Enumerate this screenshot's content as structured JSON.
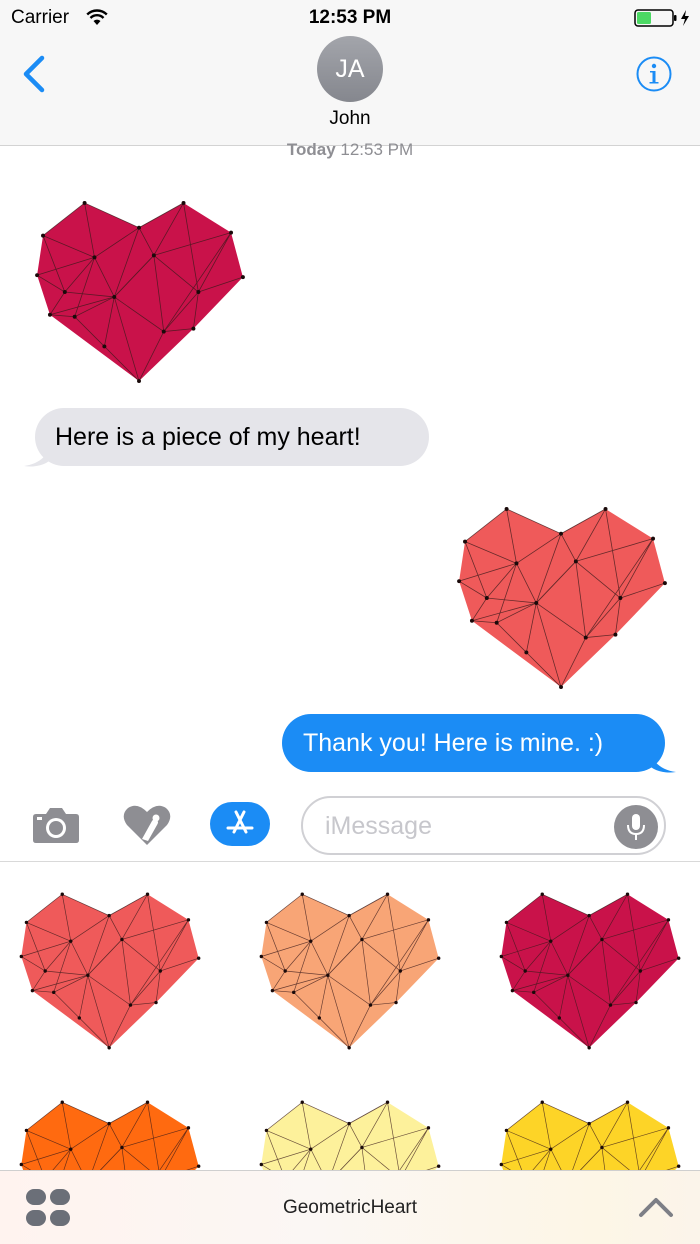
{
  "status_bar": {
    "carrier": "Carrier",
    "time": "12:53 PM"
  },
  "nav": {
    "avatar_initials": "JA",
    "contact_name": "John"
  },
  "thread": {
    "timestamp_day": "Today",
    "timestamp_time": "12:53 PM",
    "incoming_message": "Here is a piece of my heart!",
    "outgoing_message": "Thank you! Here is mine. :)"
  },
  "input": {
    "placeholder": "iMessage"
  },
  "app_drawer": {
    "app_name": "GeometricHeart",
    "stickers": [
      {
        "name": "coral-heart",
        "color": "#ef5a5a"
      },
      {
        "name": "peach-heart",
        "color": "#f8a576"
      },
      {
        "name": "crimson-heart",
        "color": "#c9124a"
      },
      {
        "name": "orange-heart",
        "color": "#ff6a10"
      },
      {
        "name": "pale-yellow-heart",
        "color": "#fdf19b"
      },
      {
        "name": "yellow-heart",
        "color": "#fdd427"
      }
    ]
  },
  "colors": {
    "accent": "#1b8cf5",
    "incoming_bubble": "#e5e5ea",
    "outgoing_bubble": "#1b8cf5"
  },
  "icons": [
    "wifi-icon",
    "battery-icon",
    "back-icon",
    "info-icon",
    "camera-icon",
    "digital-touch-icon",
    "app-store-icon",
    "microphone-icon",
    "apps-grid-icon",
    "chevron-up-icon"
  ]
}
